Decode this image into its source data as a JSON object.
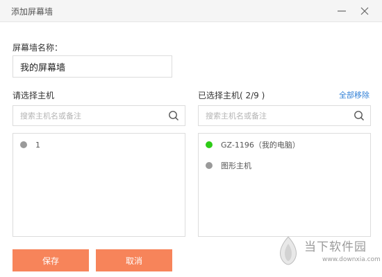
{
  "window": {
    "title": "添加屏幕墙"
  },
  "form": {
    "name_label": "屏幕墙名称：",
    "name_value": "我的屏幕墙"
  },
  "left_panel": {
    "title": "请选择主机",
    "search_placeholder": "搜索主机名或备注",
    "items": [
      {
        "label": "1",
        "status_color": "#9a9a9a"
      }
    ]
  },
  "right_panel": {
    "title": "已选择主机( 2/9 )",
    "remove_all_label": "全部移除",
    "search_placeholder": "搜索主机名或备注",
    "items": [
      {
        "label": "GZ-1196（我的电脑）",
        "status_color": "#2ecc17"
      },
      {
        "label": "图形主机",
        "status_color": "#9a9a9a"
      }
    ]
  },
  "buttons": {
    "save_label": "保存",
    "cancel_label": "取消"
  },
  "watermark": {
    "brand": "当下软件园",
    "url": "www.downxia.com"
  },
  "colors": {
    "accent": "#f7845a",
    "link": "#2f7fd6",
    "online": "#2ecc17",
    "offline": "#9a9a9a"
  }
}
